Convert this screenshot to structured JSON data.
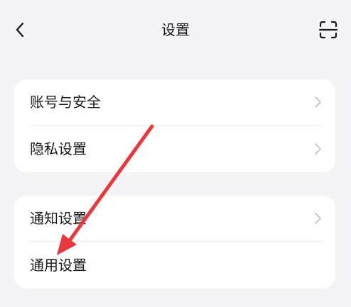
{
  "header": {
    "title": "设置",
    "back_icon": "chevron-left-icon",
    "scan_icon": "scan-icon"
  },
  "groups": [
    {
      "items": [
        {
          "label": "账号与安全",
          "has_chevron": true
        },
        {
          "label": "隐私设置",
          "has_chevron": true
        }
      ]
    },
    {
      "items": [
        {
          "label": "通知设置",
          "has_chevron": true
        },
        {
          "label": "通用设置",
          "has_chevron": false
        }
      ]
    }
  ],
  "annotation": {
    "type": "arrow",
    "color": "#e8383d",
    "points_to": "通用设置"
  },
  "colors": {
    "background": "#f4f4f6",
    "card": "#ffffff",
    "text": "#1a1a1a",
    "chevron": "#c4c4c8"
  }
}
